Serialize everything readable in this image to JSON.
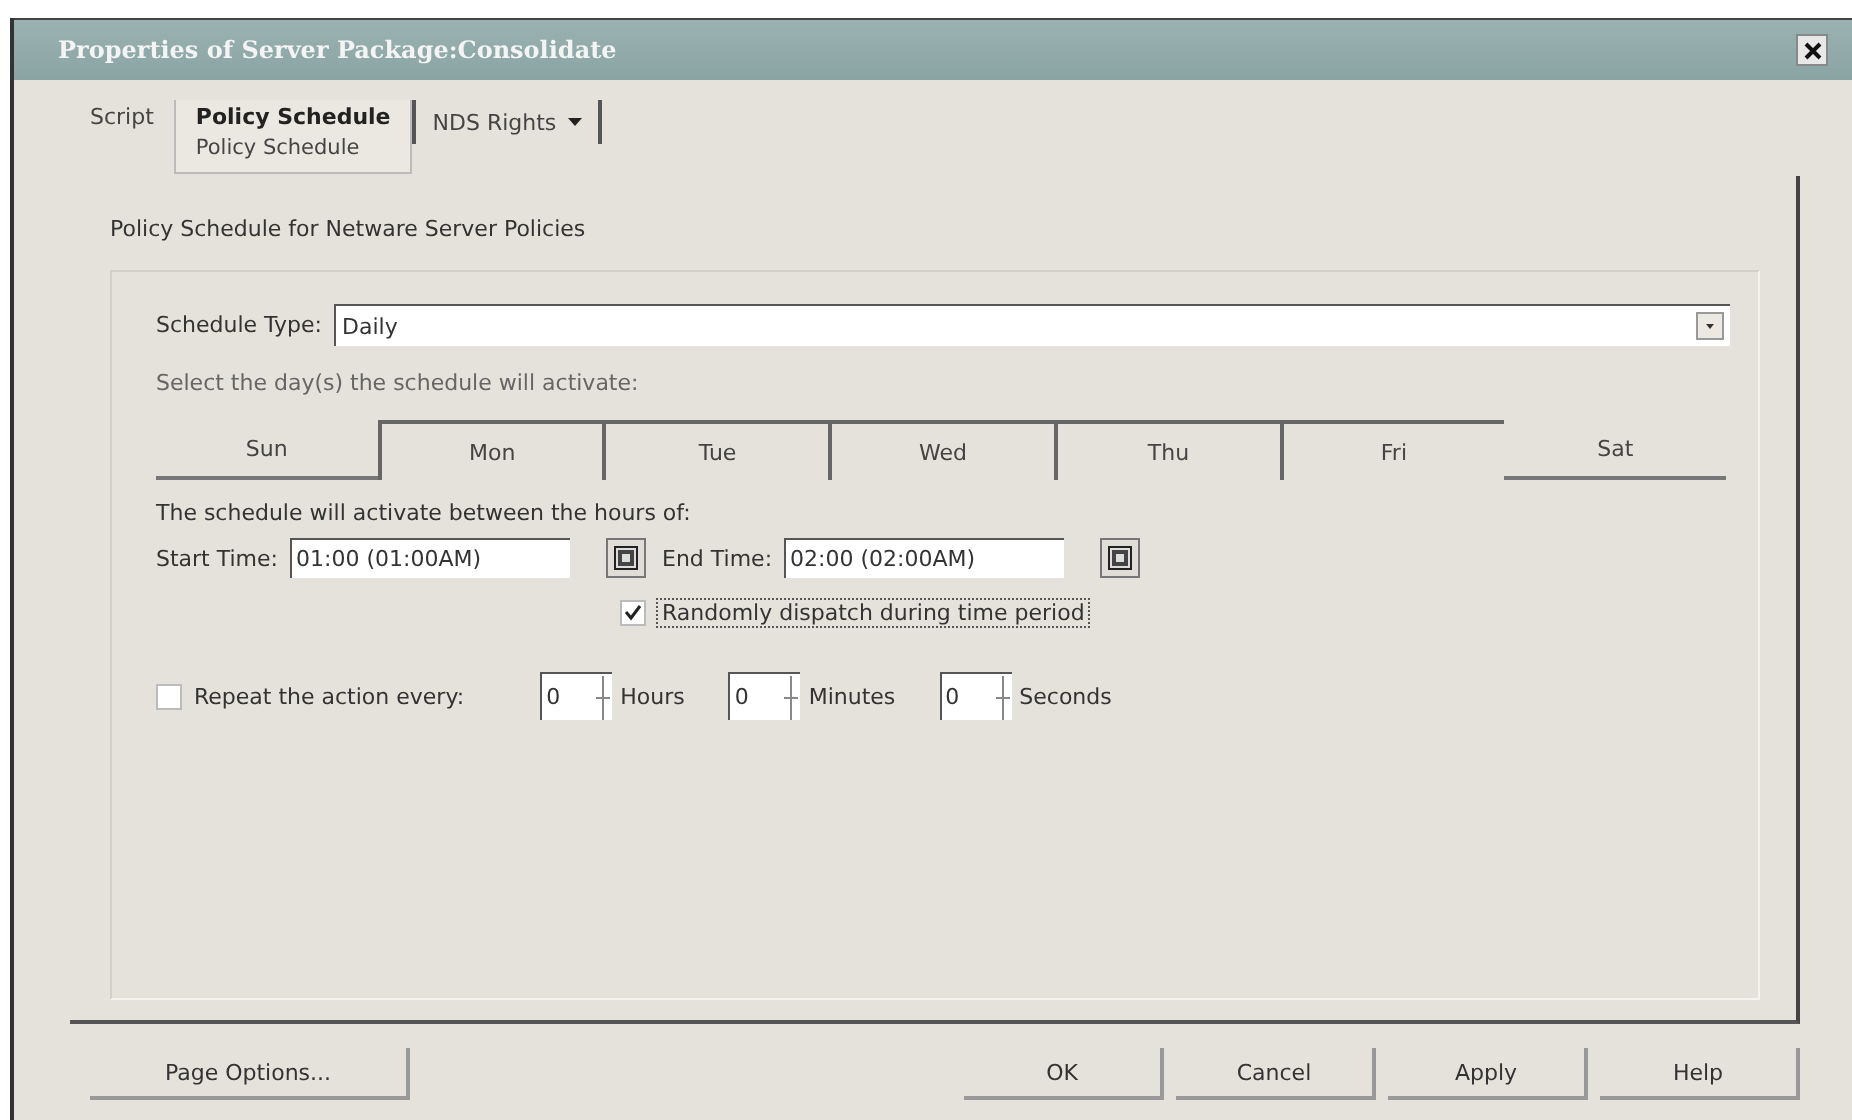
{
  "window": {
    "title": "Properties of Server Package:Consolidate"
  },
  "tabs": [
    {
      "label": "Script",
      "selected": false,
      "kind": "plain"
    },
    {
      "label": "Policy Schedule",
      "selected": true,
      "kind": "plain",
      "sublabel": "Policy Schedule"
    },
    {
      "label": "NDS Rights",
      "selected": false,
      "kind": "dropdown"
    }
  ],
  "heading": "Policy Schedule for Netware Server Policies",
  "schedule_type": {
    "label": "Schedule Type:",
    "value": "Daily"
  },
  "days_prompt": "Select the day(s) the schedule will activate:",
  "days": [
    {
      "label": "Sun",
      "selected": false
    },
    {
      "label": "Mon",
      "selected": true
    },
    {
      "label": "Tue",
      "selected": true
    },
    {
      "label": "Wed",
      "selected": true
    },
    {
      "label": "Thu",
      "selected": true
    },
    {
      "label": "Fri",
      "selected": true
    },
    {
      "label": "Sat",
      "selected": false
    }
  ],
  "hours_prompt": "The schedule will activate between the hours of:",
  "start_time": {
    "label": "Start Time:",
    "value": "01:00 (01:00AM)"
  },
  "end_time": {
    "label": "End Time:",
    "value": "02:00 (02:00AM)"
  },
  "random_dispatch": {
    "label": "Randomly dispatch during time period",
    "checked": true
  },
  "repeat": {
    "label": "Repeat the action every:",
    "checked": false
  },
  "intervals": [
    {
      "value": "0",
      "unit": "Hours"
    },
    {
      "value": "0",
      "unit": "Minutes"
    },
    {
      "value": "0",
      "unit": "Seconds"
    }
  ],
  "buttons_left": [
    "Page Options..."
  ],
  "buttons_right": [
    "OK",
    "Cancel",
    "Apply",
    "Help"
  ]
}
